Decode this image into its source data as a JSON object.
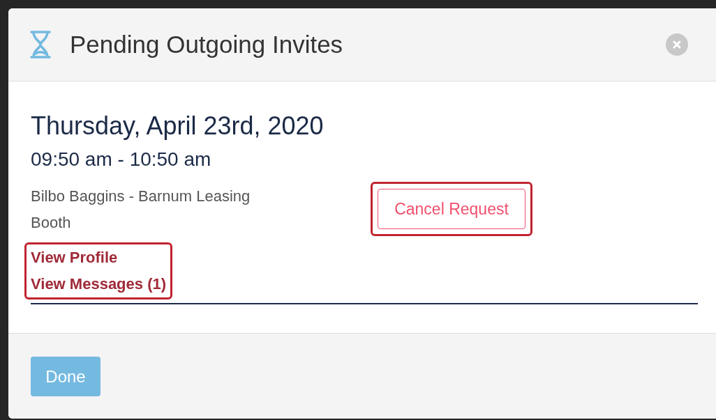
{
  "dialog": {
    "title": "Pending Outgoing Invites"
  },
  "invite": {
    "date": "Thursday, April 23rd, 2020",
    "time": "09:50 am - 10:50 am",
    "attendee": "Bilbo Baggins - Barnum Leasing Booth",
    "links": [
      "View Profile",
      "View Messages (1)"
    ],
    "cancel_button": "Cancel Request"
  },
  "footer": {
    "done_button": "Done"
  }
}
